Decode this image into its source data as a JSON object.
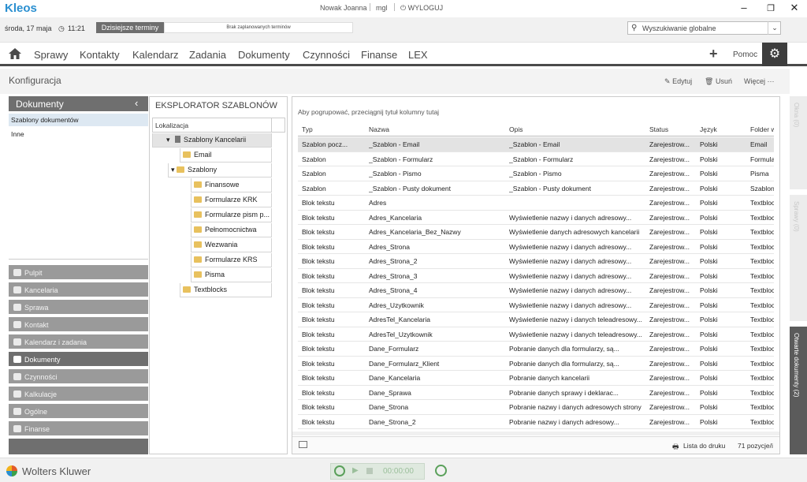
{
  "app": {
    "brand": "Kleos",
    "user": "Nowak Joanna",
    "user_code": "mgl",
    "logout": "WYLOGUJ"
  },
  "window": {
    "min": "–",
    "restore": "❐",
    "close": "✕"
  },
  "infobar": {
    "date": "środa, 17 maja",
    "time": "11:21",
    "today_label": "Dzisiejsze terminy",
    "no_terms": "Brak zaplanowanych terminów",
    "search_placeholder": "Wyszukiwanie globalne"
  },
  "nav": {
    "items": [
      "Sprawy",
      "Kontakty",
      "Kalendarz",
      "Zadania",
      "Dokumenty",
      "Czynności",
      "Finanse",
      "LEX"
    ],
    "help": "Pomoc"
  },
  "page": {
    "title": "Konfiguracja",
    "actions": {
      "edit": "Edytuj",
      "delete": "Usuń",
      "more": "Więcej"
    }
  },
  "left": {
    "header": "Dokumenty",
    "list": [
      "Szablony dokumentów",
      "Inne"
    ],
    "modules": [
      "Pulpit",
      "Kancelaria",
      "Sprawa",
      "Kontakt",
      "Kalendarz i zadania",
      "Dokumenty",
      "Czynności",
      "Kalkulacje",
      "Ogólne",
      "Finanse"
    ]
  },
  "explorer": {
    "title": "EKSPLORATOR SZABLONÓW",
    "col": "Lokalizacja",
    "root": "Szablony Kancelarii",
    "email": "Email",
    "szablony": "Szablony",
    "subfolders": [
      "Finansowe",
      "Formularze KRK",
      "Formularze pism p...",
      "Pełnomocnictwa",
      "Wezwania",
      "Formularze KRS",
      "Pisma"
    ],
    "textblocks": "Textblocks"
  },
  "grid": {
    "group_hint": "Aby pogrupować, przeciągnij tytuł kolumny tutaj",
    "columns": [
      "Typ",
      "Nazwa",
      "Opis",
      "Status",
      "Język",
      "Folder w"
    ],
    "rows": [
      [
        "Szablon pocz...",
        "_Szablon - Email",
        "_Szablon - Email",
        "Zarejestrow...",
        "Polski",
        "Email"
      ],
      [
        "Szablon",
        "_Szablon - Formularz",
        "_Szablon - Formularz",
        "Zarejestrow...",
        "Polski",
        "Formular"
      ],
      [
        "Szablon",
        "_Szablon - Pismo",
        "_Szablon - Pismo",
        "Zarejestrow...",
        "Polski",
        "Pisma"
      ],
      [
        "Szablon",
        "_Szablon - Pusty dokument",
        "_Szablon - Pusty dokument",
        "Zarejestrow...",
        "Polski",
        "Szablony"
      ],
      [
        "Blok tekstu",
        "Adres",
        "",
        "Zarejestrow...",
        "Polski",
        "Textbloc"
      ],
      [
        "Blok tekstu",
        "Adres_Kancelaria",
        "Wyświetlenie nazwy i danych adresowy...",
        "Zarejestrow...",
        "Polski",
        "Textbloc"
      ],
      [
        "Blok tekstu",
        "Adres_Kancelaria_Bez_Nazwy",
        "Wyświetlenie danych adresowych kancelarii",
        "Zarejestrow...",
        "Polski",
        "Textbloc"
      ],
      [
        "Blok tekstu",
        "Adres_Strona",
        "Wyświetlenie nazwy i danych adresowy...",
        "Zarejestrow...",
        "Polski",
        "Textbloc"
      ],
      [
        "Blok tekstu",
        "Adres_Strona_2",
        "Wyświetlenie nazwy i danych adresowy...",
        "Zarejestrow...",
        "Polski",
        "Textbloc"
      ],
      [
        "Blok tekstu",
        "Adres_Strona_3",
        "Wyświetlenie nazwy i danych adresowy...",
        "Zarejestrow...",
        "Polski",
        "Textbloc"
      ],
      [
        "Blok tekstu",
        "Adres_Strona_4",
        "Wyświetlenie nazwy i danych adresowy...",
        "Zarejestrow...",
        "Polski",
        "Textbloc"
      ],
      [
        "Blok tekstu",
        "Adres_Uzytkownik",
        "Wyświetlenie nazwy i danych adresowy...",
        "Zarejestrow...",
        "Polski",
        "Textbloc"
      ],
      [
        "Blok tekstu",
        "AdresTel_Kancelaria",
        "Wyświetlenie nazwy i danych teleadresowy...",
        "Zarejestrow...",
        "Polski",
        "Textbloc"
      ],
      [
        "Blok tekstu",
        "AdresTel_Uzytkownik",
        "Wyświetlenie nazwy i danych teleadresowy...",
        "Zarejestrow...",
        "Polski",
        "Textbloc"
      ],
      [
        "Blok tekstu",
        "Dane_Formularz",
        "Pobranie danych dla formularzy, są...",
        "Zarejestrow...",
        "Polski",
        "Textbloc"
      ],
      [
        "Blok tekstu",
        "Dane_Formularz_Klient",
        "Pobranie danych dla formularzy, są...",
        "Zarejestrow...",
        "Polski",
        "Textbloc"
      ],
      [
        "Blok tekstu",
        "Dane_Kancelaria",
        "Pobranie danych kancelarii",
        "Zarejestrow...",
        "Polski",
        "Textbloc"
      ],
      [
        "Blok tekstu",
        "Dane_Sprawa",
        "Pobranie danych sprawy i deklarac...",
        "Zarejestrow...",
        "Polski",
        "Textbloc"
      ],
      [
        "Blok tekstu",
        "Dane_Strona",
        "Pobranie nazwy i danych adresowych strony",
        "Zarejestrow...",
        "Polski",
        "Textbloc"
      ],
      [
        "Blok tekstu",
        "Dane_Strona_2",
        "Pobranie nazwy i danych adresowy...",
        "Zarejestrow...",
        "Polski",
        "Textbloc"
      ]
    ],
    "print_list": "Lista do druku",
    "count": "71 pozycje/i"
  },
  "sidetabs": [
    "Okna (0)",
    "Sprawy (0)",
    "Otwarte dokumenty (2)"
  ],
  "footer": {
    "company": "Wolters Kluwer",
    "timer": "00:00:00"
  }
}
